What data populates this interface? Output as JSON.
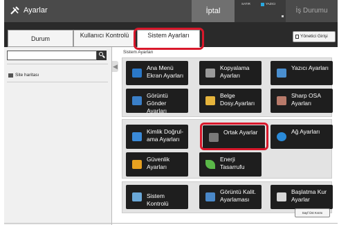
{
  "topbar": {
    "title": "Ayarlar",
    "cancel_label": "İptal",
    "status_left": "SATIR",
    "status_right": "YAZICI",
    "job_status_label": "İş Durumu",
    "accent": "#2aa8e0"
  },
  "tabs": [
    {
      "label": "Durum"
    },
    {
      "label": "Kullanıcı Kontrolü"
    },
    {
      "label": "Sistem Ayarları"
    }
  ],
  "admin_login": "Yönetici Girişi",
  "sidebar": {
    "search_value": "",
    "sitemap_label": "Site haritası"
  },
  "breadcrumb": "Sistem Ayarları",
  "groups": [
    {
      "tiles": [
        {
          "label": "Ana Menü Ekran Ayarları",
          "icon": "home-icon",
          "color": "#2a78c8"
        },
        {
          "label": "Kopyalama Ayarları",
          "icon": "copy-icon",
          "color": "#9a9a9a"
        },
        {
          "label": "Yazıcı Ayarları",
          "icon": "printer-icon",
          "color": "#4a8fd0"
        },
        {
          "label": "Görüntü Gönder Ayarları",
          "icon": "image-send-icon",
          "color": "#3a7fc8"
        },
        {
          "label": "Belge Dosy.Ayarları",
          "icon": "folder-icon",
          "color": "#e6b43c"
        },
        {
          "label": "Sharp OSA Ayarları",
          "icon": "osa-icon",
          "color": "#b87a6a"
        }
      ]
    },
    {
      "tiles": [
        {
          "label": "Kimlik Doğrul- ama Ayarları",
          "icon": "users-icon",
          "color": "#3a8ad8"
        },
        {
          "label": "Ortak Ayarlar",
          "icon": "tools-icon",
          "color": "#7a7a7a"
        },
        {
          "label": "Ağ Ayarları",
          "icon": "network-icon",
          "color": "#2a8ad8"
        },
        {
          "label": "Güvenlik Ayarları",
          "icon": "lock-icon",
          "color": "#e6a020"
        },
        {
          "label": "Enerji Tasarrufu",
          "icon": "leaf-icon",
          "color": "#5ab848"
        }
      ]
    },
    {
      "tiles": [
        {
          "label": "Sistem Kontrolü",
          "icon": "system-check-icon",
          "color": "#6aa8d8"
        },
        {
          "label": "Görüntü Kalit. Ayarlaması",
          "icon": "image-quality-icon",
          "color": "#4a88c8"
        },
        {
          "label": "Başlatma Kur Ayarlar",
          "icon": "startup-icon",
          "color": "#d8d8d8"
        }
      ]
    }
  ],
  "scroll_top": "Sayf Üst Kısmı"
}
